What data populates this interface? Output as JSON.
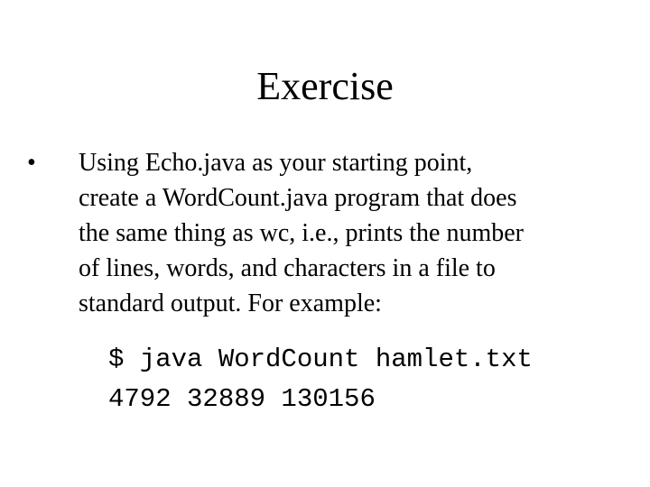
{
  "slide": {
    "title": "Exercise",
    "bullets": [
      {
        "marker": "•",
        "lines": [
          "Using Echo.java as your starting point,",
          "create a WordCount.java program that does",
          "the same thing as wc, i.e., prints the number",
          "of lines, words, and characters in a file to",
          "standard output. For example:"
        ]
      }
    ],
    "code": [
      "$ java WordCount hamlet.txt",
      "4792 32889 130156"
    ]
  }
}
